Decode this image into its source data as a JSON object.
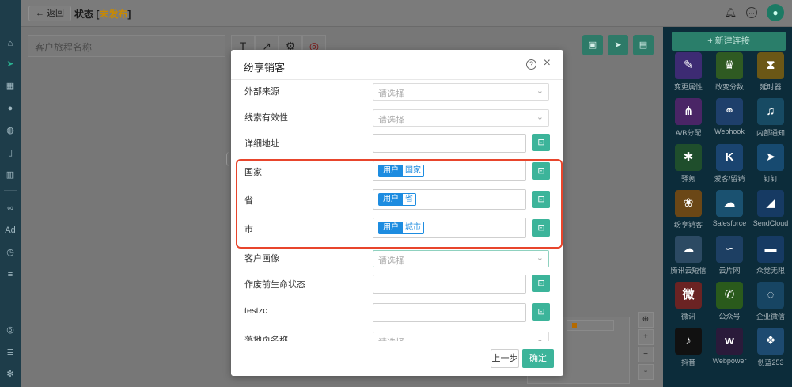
{
  "header": {
    "back_label": "返回",
    "title_prefix": "状态 [",
    "status": "未发布",
    "title_suffix": "]"
  },
  "canvas": {
    "journey_name_placeholder": "客户旅程名称",
    "tools": [
      "T",
      "↗",
      "⚙",
      "◎"
    ]
  },
  "right_panel": {
    "new_connection_label": "+ 新建连接",
    "components": [
      {
        "label": "变更属性",
        "icon": "edit-icon",
        "color": "#3d2b73",
        "glyph": "✎"
      },
      {
        "label": "改变分数",
        "icon": "trophy-icon",
        "color": "#2f5a22",
        "glyph": "♛"
      },
      {
        "label": "延时器",
        "icon": "hourglass-icon",
        "color": "#6b5716",
        "glyph": "⧗"
      },
      {
        "label": "A/B分配",
        "icon": "ab-split-icon",
        "color": "#4a2566",
        "glyph": "⋔"
      },
      {
        "label": "Webhook",
        "icon": "webhook-icon",
        "color": "#1e3f6b",
        "glyph": "⚭"
      },
      {
        "label": "内部通知",
        "icon": "bell-icon",
        "color": "#174a63",
        "glyph": "♫"
      },
      {
        "label": "驿氪",
        "icon": "spider-icon",
        "color": "#1f4e2c",
        "glyph": "✱"
      },
      {
        "label": "爱客/留销",
        "icon": "k-icon",
        "color": "#1a4470",
        "glyph": "K"
      },
      {
        "label": "钉钉",
        "icon": "dingtalk-icon",
        "color": "#174a70",
        "glyph": "➤"
      },
      {
        "label": "纷享销客",
        "icon": "fxiaoke-icon",
        "color": "#6b4716",
        "glyph": "❀"
      },
      {
        "label": "Salesforce",
        "icon": "salesforce-icon",
        "color": "#1a5170",
        "glyph": "☁"
      },
      {
        "label": "SendCloud",
        "icon": "sendcloud-icon",
        "color": "#163a63",
        "glyph": "◢"
      },
      {
        "label": "腾讯云短信",
        "icon": "tencent-cloud-icon",
        "color": "#2c4a63",
        "glyph": "☁"
      },
      {
        "label": "云片网",
        "icon": "yunpian-icon",
        "color": "#1d3f63",
        "glyph": "∽"
      },
      {
        "label": "众觉无限",
        "icon": "zhongjue-icon",
        "color": "#163a63",
        "glyph": "▬"
      },
      {
        "label": "微讯",
        "icon": "weixun-icon",
        "color": "#6b2323",
        "glyph": "微"
      },
      {
        "label": "公众号",
        "icon": "wechat-icon",
        "color": "#2a5a1c",
        "glyph": "✆"
      },
      {
        "label": "企业微信",
        "icon": "wecom-icon",
        "color": "#174563",
        "glyph": "◌"
      },
      {
        "label": "抖音",
        "icon": "douyin-icon",
        "color": "#111111",
        "glyph": "♪"
      },
      {
        "label": "Webpower",
        "icon": "webpower-icon",
        "color": "#2a1a3a",
        "glyph": "w"
      },
      {
        "label": "创蓝253",
        "icon": "chuanglan-icon",
        "color": "#1d4a70",
        "glyph": "❖"
      }
    ]
  },
  "modal": {
    "title": "纷享销客",
    "fields": [
      {
        "label": "外部来源",
        "kind": "select",
        "placeholder": "请选择"
      },
      {
        "label": "线索有效性",
        "kind": "select",
        "placeholder": "请选择"
      },
      {
        "label": "详细地址",
        "kind": "input"
      },
      {
        "label": "国家",
        "kind": "chip",
        "chip_a": "用户",
        "chip_b": "国家"
      },
      {
        "label": "省",
        "kind": "chip",
        "chip_a": "用户",
        "chip_b": "省"
      },
      {
        "label": "市",
        "kind": "chip",
        "chip_a": "用户",
        "chip_b": "城市"
      },
      {
        "label": "客户画像",
        "kind": "select",
        "placeholder": "请选择"
      },
      {
        "label": "作废前生命状态",
        "kind": "input"
      },
      {
        "label": "testzc",
        "kind": "input"
      },
      {
        "label": "落地页名称",
        "kind": "select",
        "placeholder": "请选择"
      }
    ],
    "prev_label": "上一步",
    "ok_label": "确定"
  }
}
